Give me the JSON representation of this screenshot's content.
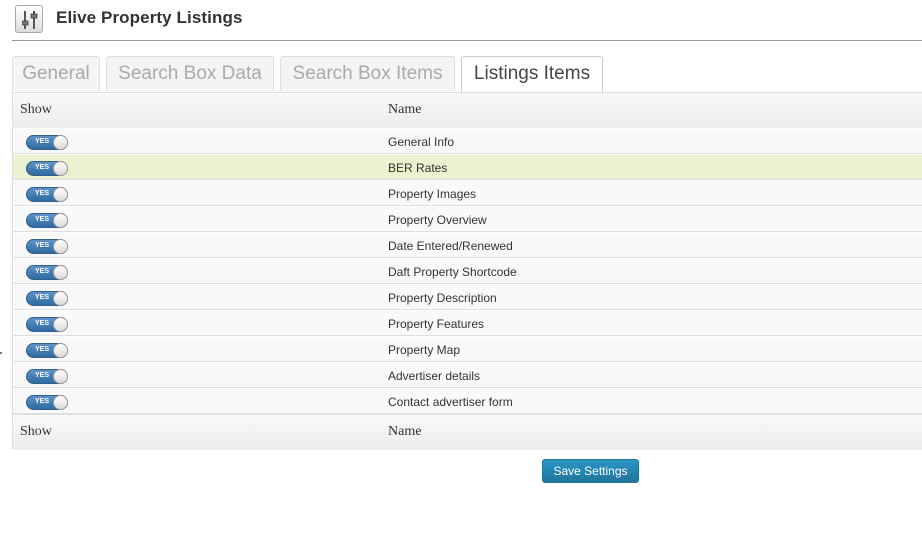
{
  "header": {
    "title": "Elive Property Listings",
    "icon": "settings-sliders-icon"
  },
  "tabs": [
    {
      "label": "General",
      "active": false
    },
    {
      "label": "Search Box Data",
      "active": false
    },
    {
      "label": "Search Box Items",
      "active": false
    },
    {
      "label": "Listings Items",
      "active": true
    }
  ],
  "table": {
    "col_show": "Show",
    "col_name": "Name",
    "toggle_label": "YES",
    "rows": [
      {
        "name": "General Info",
        "on": true
      },
      {
        "name": "BER Rates",
        "on": true,
        "highlighted": true
      },
      {
        "name": "Property Images",
        "on": true
      },
      {
        "name": "Property Overview",
        "on": true
      },
      {
        "name": "Date Entered/Renewed",
        "on": true
      },
      {
        "name": "Daft Property Shortcode",
        "on": true
      },
      {
        "name": "Property Description",
        "on": true
      },
      {
        "name": "Property Features",
        "on": true
      },
      {
        "name": "Property Map",
        "on": true
      },
      {
        "name": "Advertiser details",
        "on": true
      },
      {
        "name": "Contact advertiser form",
        "on": true
      }
    ]
  },
  "save_button": "Save Settings",
  "colors": {
    "accent": "#21759b",
    "toggle_on": "#3a78b2",
    "row_highlight": "#eaf2cf"
  }
}
